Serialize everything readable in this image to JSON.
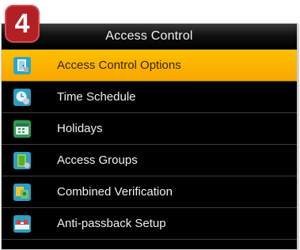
{
  "step_badge": "4",
  "window": {
    "title": "Access Control"
  },
  "menu": {
    "items": [
      {
        "label": "Access Control Options",
        "icon": "door-options-icon",
        "selected": true
      },
      {
        "label": "Time Schedule",
        "icon": "clock-schedule-icon",
        "selected": false
      },
      {
        "label": "Holidays",
        "icon": "calendar-holiday-icon",
        "selected": false
      },
      {
        "label": "Access Groups",
        "icon": "access-group-icon",
        "selected": false
      },
      {
        "label": "Combined Verification",
        "icon": "combined-verification-icon",
        "selected": false
      },
      {
        "label": "Anti-passback Setup",
        "icon": "anti-passback-icon",
        "selected": false
      }
    ]
  },
  "colors": {
    "selected_bg": "#ffb800",
    "screen_bg": "#000000",
    "badge_bg": "#b21f24"
  }
}
